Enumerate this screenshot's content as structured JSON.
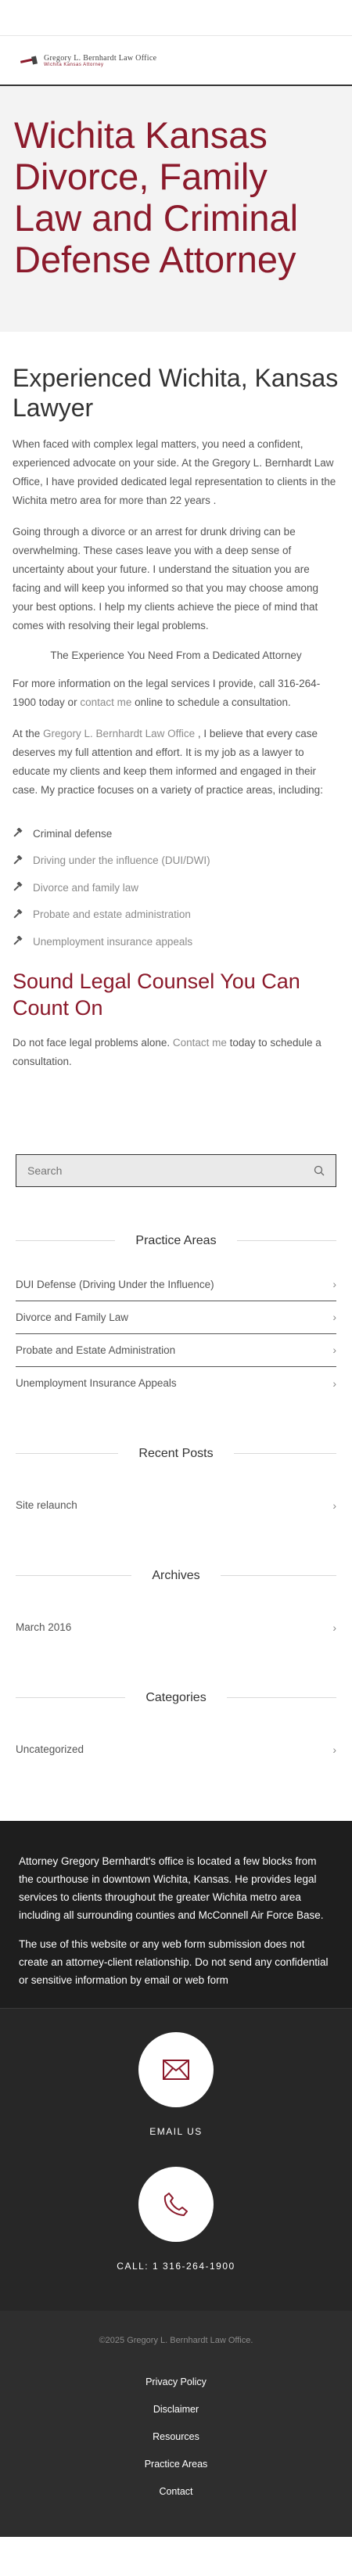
{
  "header": {
    "logo_line1": "Gregory L. Bernhardt Law Office",
    "logo_line2": "Wichita Kansas Attorney",
    "logo_icon": "gavel-icon"
  },
  "hero": {
    "title": "Wichita Kansas Divorce, Family Law and Criminal Defense Attorney"
  },
  "main": {
    "heading": "Experienced Wichita, Kansas Lawyer",
    "p1": "When faced with complex legal matters, you need a confident, experienced advocate on your side. At the Gregory L. Bernhardt Law Office, I have provided dedicated legal representation to clients in the Wichita metro area for more than 22 years .",
    "p2": "Going through a divorce or an arrest for drunk driving can be overwhelming. These cases leave you with a deep sense of uncertainty about your future. I understand the situation you are facing and will keep you informed so that you may choose among your best options. I help my clients achieve the piece of mind that comes with resolving their legal problems.",
    "tagline": "The Experience You Need From a Dedicated Attorney",
    "p3_pre": "For more information on the legal services I provide, call 316-264-1900 today or ",
    "p3_link": "contact me",
    "p3_post": " online to schedule a consultation.",
    "p4_pre": "At the ",
    "p4_link": "Gregory L. Bernhardt Law Office",
    "p4_post": " , I believe that every case deserves my full attention and effort. It is my job as a lawyer to educate my clients and keep them informed and engaged in their case. My practice focuses on a variety of practice areas, including:",
    "practice_items": [
      {
        "label": "Criminal defense",
        "link": false
      },
      {
        "label": "Driving under the influence (DUI/DWI)",
        "link": true
      },
      {
        "label": "Divorce and family law",
        "link": true
      },
      {
        "label": "Probate and estate administration",
        "link": true
      },
      {
        "label": "Unemployment insurance appeals",
        "link": true
      }
    ],
    "subheading": "Sound Legal Counsel You Can Count On",
    "p5_pre": "Do not face legal problems alone. ",
    "p5_link": "Contact me",
    "p5_post": " today to schedule a consultation."
  },
  "sidebar": {
    "search_placeholder": "Search",
    "practice_title": "Practice Areas",
    "practice_areas": [
      "DUI Defense (Driving Under the Influence)",
      "Divorce and Family Law",
      "Probate and Estate Administration",
      "Unemployment Insurance Appeals"
    ],
    "recent_title": "Recent Posts",
    "recent_posts": [
      "Site relaunch"
    ],
    "archives_title": "Archives",
    "archives": [
      "March 2016"
    ],
    "categories_title": "Categories",
    "categories": [
      "Uncategorized"
    ]
  },
  "footer": {
    "about": "Attorney Gregory Bernhardt's office is located a few blocks from the courthouse in downtown Wichita, Kansas. He provides legal services to clients throughout the greater Wichita metro area including all surrounding counties and McConnell Air Force Base.",
    "disclaimer": "The use of this website or any web form submission does not create an attorney-client relationship. Do not send any confidential or sensitive information by email or web form",
    "email_label": "EMAIL US",
    "call_label": "CALL: 1 316-264-1900",
    "copyright": "©2025 Gregory L. Bernhardt Law Office.",
    "links": [
      "Privacy Policy",
      "Disclaimer",
      "Resources",
      "Practice Areas",
      "Contact"
    ]
  },
  "colors": {
    "brand": "#8b1a2b",
    "footer_dark": "#1e1e1e"
  }
}
